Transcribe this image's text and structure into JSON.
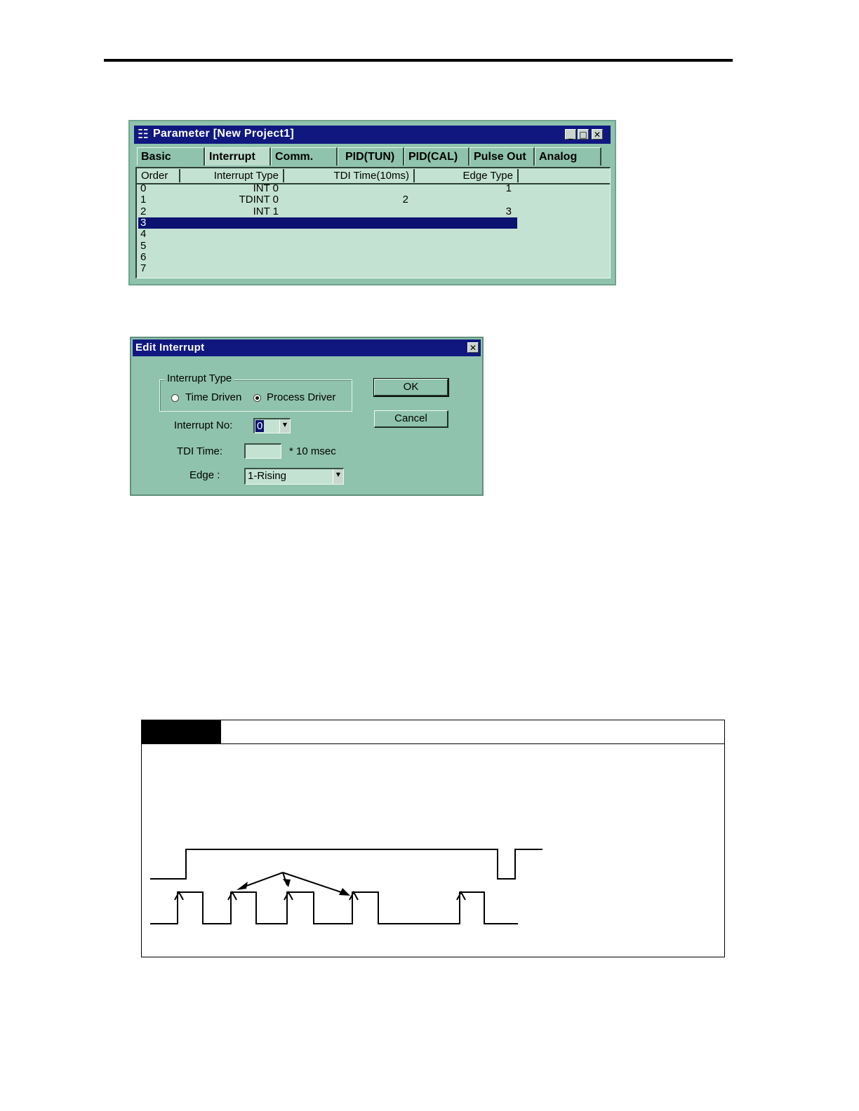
{
  "parameter_window": {
    "app_icon": "app-grid-icon",
    "title": "Parameter [New Project1]",
    "window_buttons": [
      "minimize-icon",
      "maximize-icon",
      "close-icon"
    ],
    "tabs": [
      {
        "label": "Basic",
        "active": false
      },
      {
        "label": "Interrupt",
        "active": true
      },
      {
        "label": "Comm.",
        "active": false
      },
      {
        "label": "PID(TUN)",
        "active": false
      },
      {
        "label": "PID(CAL)",
        "active": false
      },
      {
        "label": "Pulse Out",
        "active": false
      },
      {
        "label": "Analog",
        "active": false
      }
    ],
    "columns": [
      "Order",
      "Interrupt Type",
      "TDI Time(10ms)",
      "Edge Type"
    ],
    "rows": [
      {
        "order": "0",
        "type": "INT 0",
        "tdi": "",
        "edge": "1"
      },
      {
        "order": "1",
        "type": "TDINT 0",
        "tdi": "2",
        "edge": ""
      },
      {
        "order": "2",
        "type": "INT 1",
        "tdi": "",
        "edge": "3"
      },
      {
        "order": "3",
        "type": "",
        "tdi": "",
        "edge": "",
        "selected": true
      },
      {
        "order": "4",
        "type": "",
        "tdi": "",
        "edge": ""
      },
      {
        "order": "5",
        "type": "",
        "tdi": "",
        "edge": ""
      },
      {
        "order": "6",
        "type": "",
        "tdi": "",
        "edge": ""
      },
      {
        "order": "7",
        "type": "",
        "tdi": "",
        "edge": ""
      }
    ]
  },
  "edit_dialog": {
    "title": "Edit Interrupt",
    "group_label": "Interrupt Type",
    "radio_time": "Time Driven",
    "radio_process": "Process Driver",
    "selected_radio": "process",
    "interrupt_no_label": "Interrupt No:",
    "interrupt_no_value": "0",
    "tdi_label": "TDI Time:",
    "tdi_value": "",
    "tdi_unit": "* 10 msec",
    "edge_label": "Edge :",
    "edge_value": "1-Rising",
    "ok_label": "OK",
    "cancel_label": "Cancel"
  }
}
